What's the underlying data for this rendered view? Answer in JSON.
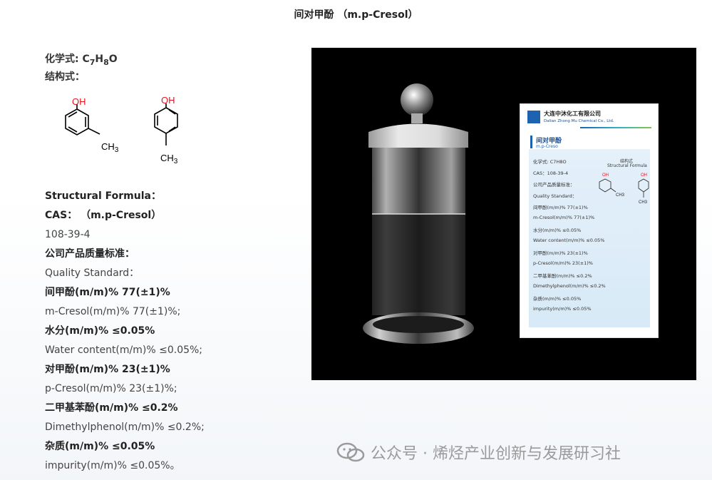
{
  "title": "间对甲酚 （m.p-Cresol）",
  "formula": {
    "label": "化学式: ",
    "c": "C",
    "c_sub": "7",
    "h": "H",
    "h_sub": "8",
    "o": "O"
  },
  "structure_label": "结构式：",
  "structure": {
    "oh1": "OH",
    "ch3_1": "CH",
    "ch3_1_sub": "3",
    "oh2": "OH",
    "ch3_2": "CH",
    "ch3_2_sub": "3"
  },
  "lines": [
    {
      "text": "Structural Formula：",
      "bold": true
    },
    {
      "text": "CAS： （m.p-Cresol）",
      "bold": true
    },
    {
      "text": "108-39-4",
      "bold": false
    },
    {
      "text": "公司产品质量标准：",
      "bold": true
    },
    {
      "text": "Quality Standard：",
      "bold": false
    },
    {
      "text": "间甲酚(m/m)% 77(±1)%",
      "bold": true
    },
    {
      "text": "m-Cresol(m/m)% 77(±1)%;",
      "bold": false
    },
    {
      "text": "水分(m/m)% ≤0.05%",
      "bold": true
    },
    {
      "text": "Water content(m/m)% ≤0.05%;",
      "bold": false
    },
    {
      "text": "对甲酚(m/m)% 23(±1)%",
      "bold": true
    },
    {
      "text": "p-Cresol(m/m)% 23(±1)%;",
      "bold": false
    },
    {
      "text": "二甲基苯酚(m/m)% ≤0.2%",
      "bold": true
    },
    {
      "text": "Dimethylphenol(m/m)% ≤0.2%;",
      "bold": false
    },
    {
      "text": "杂质(m/m)% ≤0.05%",
      "bold": true
    },
    {
      "text": "impurity(m/m)% ≤0.05%。",
      "bold": false
    }
  ],
  "label_card": {
    "company_cn": "大连中沐化工有限公司",
    "company_en": "Dalian Zhong Mu Chemical Co., Ltd.",
    "product_cn": "间对甲酚",
    "product_en": "m.p-Creso",
    "struct_cn": "结构式",
    "struct_en": "Structural Formula",
    "oh_a": "OH",
    "ch3_a": "CH3",
    "oh_b": "OH",
    "ch3_b": "CH3",
    "rows": [
      "化学式: C7H8O",
      "CAS：108-39-4",
      "公司产品质量标准：",
      "Quality Standard：",
      "间甲酚(m/m)% 77(±1)%",
      "m-Cresol(m/m)% 77(±1)%",
      "水分(m/m)% ≤0.05%",
      "Water content(m/m)% ≤0.05%",
      "对甲酚(m/m)% 23(±1)%",
      "p-Cresol(m/m)% 23(±1)%",
      "二甲基苯酚(m/m)% ≤0.2%",
      "Dimethylphenol(m/m)% ≤0.2%",
      "杂质(m/m)% ≤0.05%",
      "impurity(m/m)% ≤0.05%"
    ]
  },
  "watermark": {
    "text": "公众号 · 烯烃产业创新与发展研习社",
    "icon": "wechat-icon"
  }
}
